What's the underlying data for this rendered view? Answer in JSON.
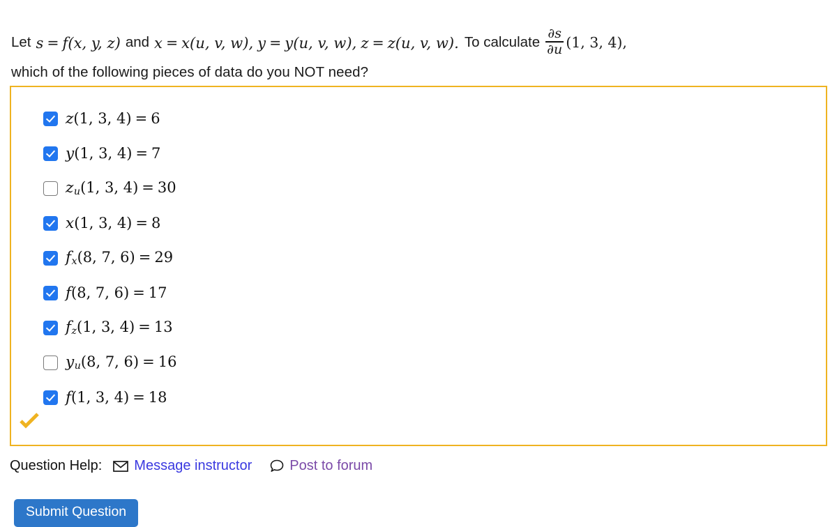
{
  "question": {
    "line1": {
      "lead": "Let",
      "s": "s",
      "eq1": "=",
      "f": "f",
      "args1": "(x, y, z)",
      "and": "and",
      "x": "x",
      "eq2": "=",
      "xfun": "x",
      "args2": "(u, v, w),",
      "y": "y",
      "eq3": "=",
      "yfun": "y",
      "args3": "(u, v, w),",
      "z": "z",
      "eq4": "=",
      "zfun": "z",
      "args4": "(u, v, w).",
      "tocalc": "To calculate",
      "frac_num": "∂s",
      "frac_den": "∂u",
      "point": "(1, 3, 4),"
    },
    "line2": "which of the following pieces of data do you NOT need?"
  },
  "choices": [
    {
      "checked": true,
      "symbol": "z",
      "sub": "",
      "args": "(1, 3, 4)",
      "eq": "=",
      "value": "6"
    },
    {
      "checked": true,
      "symbol": "y",
      "sub": "",
      "args": "(1, 3, 4)",
      "eq": "=",
      "value": "7"
    },
    {
      "checked": false,
      "symbol": "z",
      "sub": "u",
      "args": "(1, 3, 4)",
      "eq": "=",
      "value": "30"
    },
    {
      "checked": true,
      "symbol": "x",
      "sub": "",
      "args": "(1, 3, 4)",
      "eq": "=",
      "value": "8"
    },
    {
      "checked": true,
      "symbol": "f",
      "sub": "x",
      "args": "(8, 7, 6)",
      "eq": "=",
      "value": "29"
    },
    {
      "checked": true,
      "symbol": "f",
      "sub": "",
      "args": "(8, 7, 6)",
      "eq": "=",
      "value": "17"
    },
    {
      "checked": true,
      "symbol": "f",
      "sub": "z",
      "args": "(1, 3, 4)",
      "eq": "=",
      "value": "13"
    },
    {
      "checked": false,
      "symbol": "y",
      "sub": "u",
      "args": "(8, 7, 6)",
      "eq": "=",
      "value": "16"
    },
    {
      "checked": true,
      "symbol": "f",
      "sub": "",
      "args": "(1, 3, 4)",
      "eq": "=",
      "value": "18"
    }
  ],
  "help": {
    "label": "Question Help:",
    "message_instructor": "Message instructor",
    "post_to_forum": "Post to forum"
  },
  "submit": {
    "label": "Submit Question"
  },
  "colors": {
    "box_border": "#efb321",
    "checkbox_checked": "#2176ef",
    "gold_check": "#efb321",
    "link_message": "#3a39e0",
    "link_forum": "#7b4aa8",
    "submit_bg": "#2d77c9"
  },
  "icons": {
    "envelope": "envelope-icon",
    "speech_bubble": "speech-bubble-icon",
    "gold_check": "gold-checkmark-icon"
  }
}
